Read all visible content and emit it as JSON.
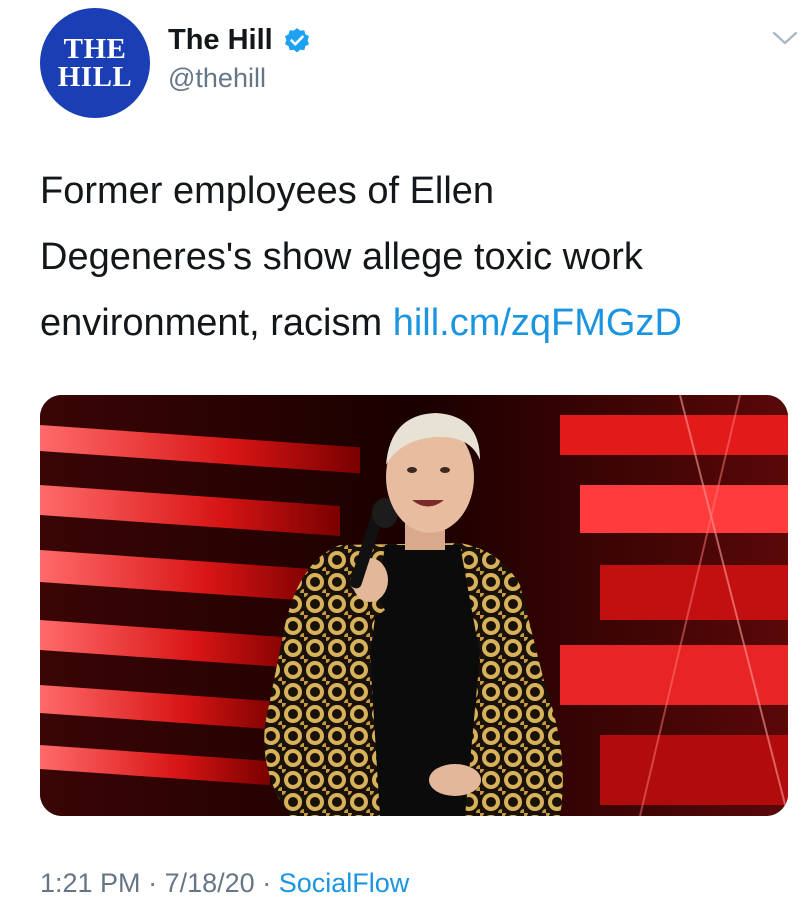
{
  "account": {
    "avatar_line1": "THE",
    "avatar_line2": "HILL",
    "display_name": "The Hill",
    "handle": "@thehill",
    "verified_icon": "verified-badge-icon",
    "brand_color": "#1a3fb5"
  },
  "tweet": {
    "text_line1": "Former employees of Ellen",
    "text_line2": "Degeneres's show allege toxic work",
    "text_line3": "environment, racism",
    "link": "hill.cm/zqFMGzD",
    "time": "1:21 PM",
    "separator": "·",
    "date": "7/18/20",
    "source": "SocialFlow"
  },
  "colors": {
    "link": "#1b95e0",
    "secondary_text": "#657786",
    "primary_text": "#14171a"
  },
  "icons": {
    "more": "chevron-down-icon"
  }
}
